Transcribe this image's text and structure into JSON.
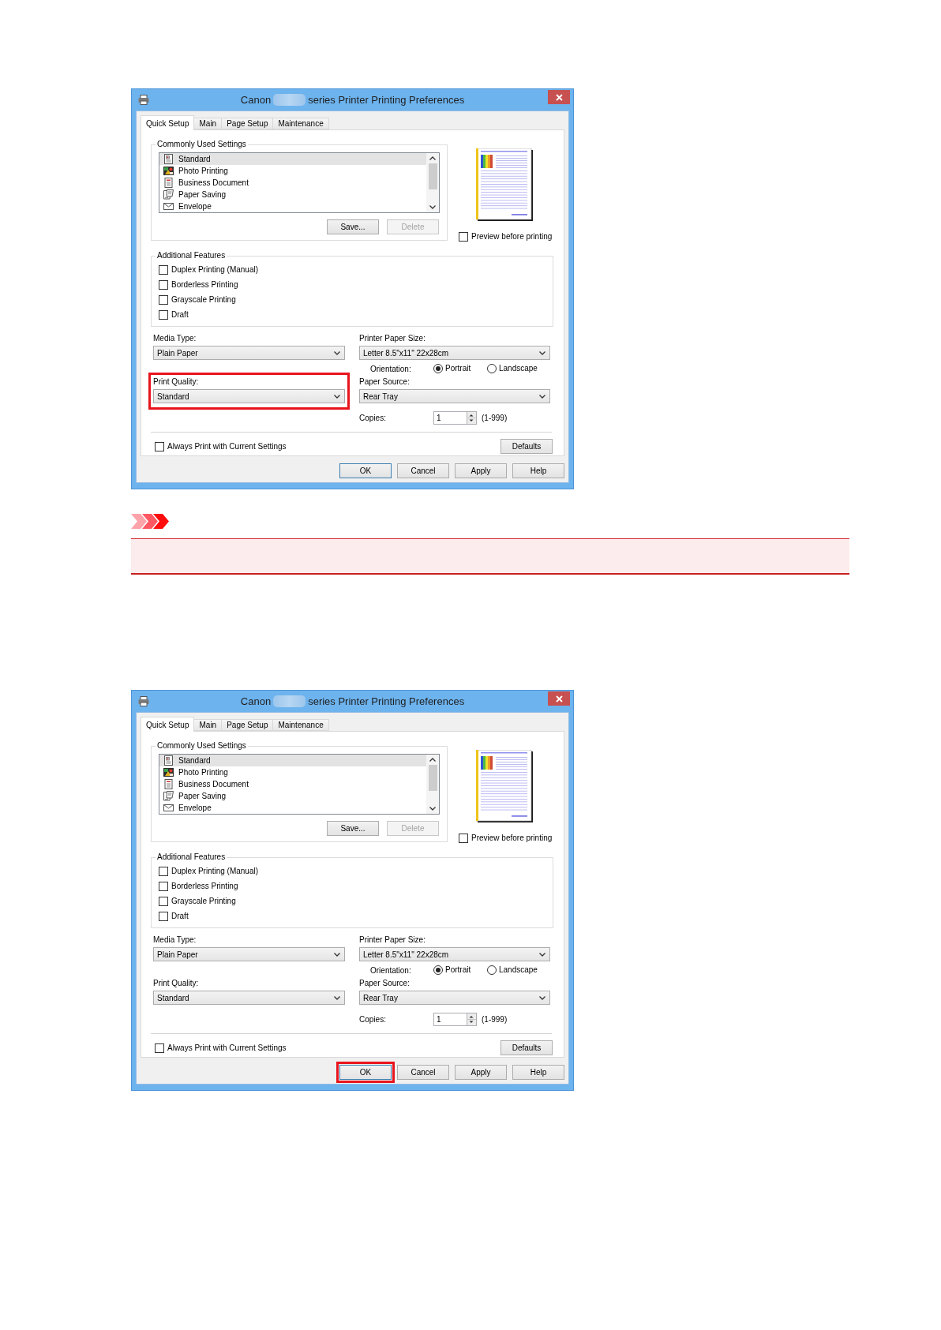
{
  "dialogs": [
    {
      "title_start": "Canon",
      "title_end": "series Printer Printing Preferences",
      "tabs": [
        {
          "label": "Quick Setup",
          "selected": true
        },
        {
          "label": "Main",
          "selected": false
        },
        {
          "label": "Page Setup",
          "selected": false
        },
        {
          "label": "Maintenance",
          "selected": false
        }
      ],
      "commonly_used_settings": {
        "label": "Commonly Used Settings",
        "items": [
          {
            "label": "Standard",
            "kind": "standard",
            "selected": true
          },
          {
            "label": "Photo Printing",
            "kind": "photo",
            "selected": false
          },
          {
            "label": "Business Document",
            "kind": "business",
            "selected": false
          },
          {
            "label": "Paper Saving",
            "kind": "paper_saving",
            "selected": false
          },
          {
            "label": "Envelope",
            "kind": "envelope",
            "selected": false
          }
        ],
        "buttons": [
          {
            "label": "Save...",
            "disabled": false
          },
          {
            "label": "Delete",
            "disabled": true
          }
        ]
      },
      "preview_before_printing": {
        "label": "Preview before printing",
        "checked": false
      },
      "additional_features": {
        "label": "Additional Features",
        "options": [
          {
            "label": "Duplex Printing (Manual)",
            "checked": false
          },
          {
            "label": "Borderless Printing",
            "checked": false
          },
          {
            "label": "Grayscale Printing",
            "checked": false
          },
          {
            "label": "Draft",
            "checked": false
          }
        ]
      },
      "media_type": {
        "label": "Media Type:",
        "value": "Plain Paper"
      },
      "printer_paper_size": {
        "label": "Printer Paper Size:",
        "value": "Letter 8.5\"x11\" 22x28cm"
      },
      "orientation": {
        "label": "Orientation:",
        "options": [
          {
            "label": "Portrait",
            "selected": true
          },
          {
            "label": "Landscape",
            "selected": false
          }
        ]
      },
      "print_quality": {
        "label": "Print Quality:",
        "value": "Standard",
        "highlighted": true
      },
      "paper_source": {
        "label": "Paper Source:",
        "value": "Rear Tray"
      },
      "copies": {
        "label": "Copies:",
        "value": "1",
        "range": "(1-999)"
      },
      "always_print": {
        "label": "Always Print with Current Settings",
        "checked": false
      },
      "defaults_button": "Defaults",
      "buttons": [
        {
          "label": "OK",
          "focused": true,
          "highlighted": false
        },
        {
          "label": "Cancel",
          "focused": false,
          "highlighted": false
        },
        {
          "label": "Apply",
          "focused": false,
          "highlighted": false
        },
        {
          "label": "Help",
          "focused": false,
          "highlighted": false
        }
      ]
    },
    {
      "title_start": "Canon",
      "title_end": "series Printer Printing Preferences",
      "tabs": [
        {
          "label": "Quick Setup",
          "selected": true
        },
        {
          "label": "Main",
          "selected": false
        },
        {
          "label": "Page Setup",
          "selected": false
        },
        {
          "label": "Maintenance",
          "selected": false
        }
      ],
      "commonly_used_settings": {
        "label": "Commonly Used Settings",
        "items": [
          {
            "label": "Standard",
            "kind": "standard",
            "selected": true
          },
          {
            "label": "Photo Printing",
            "kind": "photo",
            "selected": false
          },
          {
            "label": "Business Document",
            "kind": "business",
            "selected": false
          },
          {
            "label": "Paper Saving",
            "kind": "paper_saving",
            "selected": false
          },
          {
            "label": "Envelope",
            "kind": "envelope",
            "selected": false
          }
        ],
        "buttons": [
          {
            "label": "Save...",
            "disabled": false
          },
          {
            "label": "Delete",
            "disabled": true
          }
        ]
      },
      "preview_before_printing": {
        "label": "Preview before printing",
        "checked": false
      },
      "additional_features": {
        "label": "Additional Features",
        "options": [
          {
            "label": "Duplex Printing (Manual)",
            "checked": false
          },
          {
            "label": "Borderless Printing",
            "checked": false
          },
          {
            "label": "Grayscale Printing",
            "checked": false
          },
          {
            "label": "Draft",
            "checked": false
          }
        ]
      },
      "media_type": {
        "label": "Media Type:",
        "value": "Plain Paper"
      },
      "printer_paper_size": {
        "label": "Printer Paper Size:",
        "value": "Letter 8.5\"x11\" 22x28cm"
      },
      "orientation": {
        "label": "Orientation:",
        "options": [
          {
            "label": "Portrait",
            "selected": true
          },
          {
            "label": "Landscape",
            "selected": false
          }
        ]
      },
      "print_quality": {
        "label": "Print Quality:",
        "value": "Standard",
        "highlighted": false
      },
      "paper_source": {
        "label": "Paper Source:",
        "value": "Rear Tray"
      },
      "copies": {
        "label": "Copies:",
        "value": "1",
        "range": "(1-999)"
      },
      "always_print": {
        "label": "Always Print with Current Settings",
        "checked": false
      },
      "defaults_button": "Defaults",
      "buttons": [
        {
          "label": "OK",
          "focused": true,
          "highlighted": true
        },
        {
          "label": "Cancel",
          "focused": false,
          "highlighted": false
        },
        {
          "label": "Apply",
          "focused": false,
          "highlighted": false
        },
        {
          "label": "Help",
          "focused": false,
          "highlighted": false
        }
      ]
    }
  ]
}
